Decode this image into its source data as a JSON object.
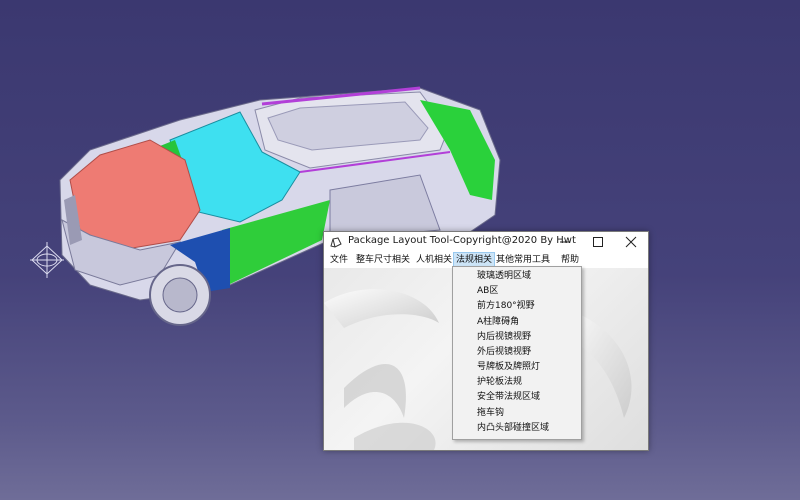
{
  "window": {
    "title": "Package Layout Tool-Copyright@2020 By Hwt",
    "minimize_icon": "minimize-icon",
    "maximize_icon": "maximize-icon",
    "close_icon": "close-icon"
  },
  "menu": {
    "items": [
      {
        "label": "文件"
      },
      {
        "label": "整车尺寸相关"
      },
      {
        "label": "人机相关"
      },
      {
        "label": "法规相关",
        "active": true
      },
      {
        "label": "其他常用工具"
      },
      {
        "label": "帮助"
      }
    ]
  },
  "dropdown": {
    "items": [
      {
        "label": "玻璃透明区域"
      },
      {
        "label": "AB区"
      },
      {
        "label": "前方180°视野"
      },
      {
        "label": "A柱障碍角"
      },
      {
        "label": "内后视镜视野"
      },
      {
        "label": "外后视镜视野"
      },
      {
        "label": "号牌板及牌照灯"
      },
      {
        "label": "护轮板法规"
      },
      {
        "label": "安全带法规区域"
      },
      {
        "label": "拖车钩"
      },
      {
        "label": "内凸头部碰撞区域"
      }
    ]
  },
  "colors": {
    "background": "#3b3870",
    "menu_highlight": "#cce4f7"
  }
}
